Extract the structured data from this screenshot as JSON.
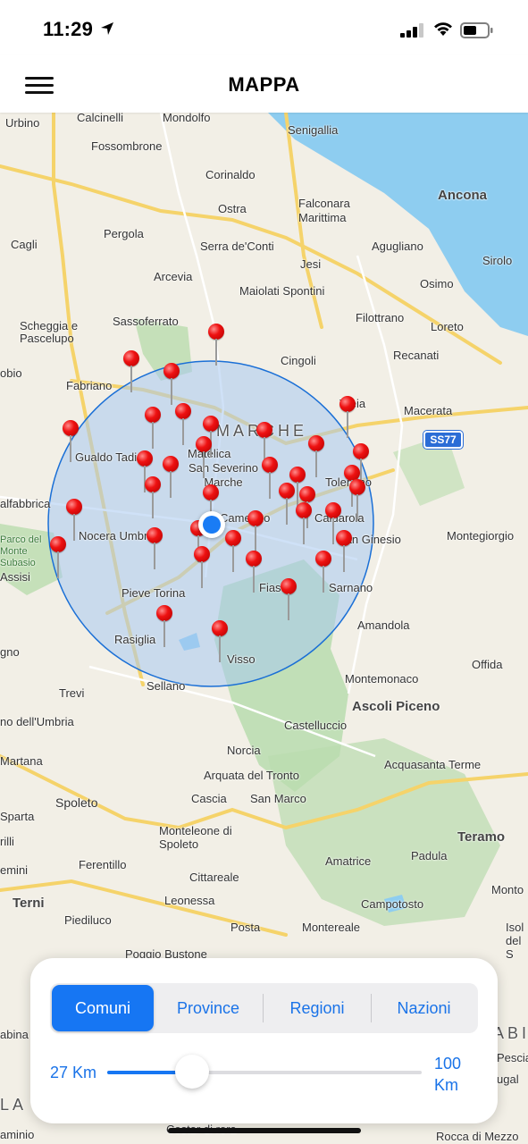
{
  "status_bar": {
    "time": "11:29"
  },
  "nav": {
    "title": "MAPPA"
  },
  "map": {
    "region_label": "MARCHE",
    "road_badge": "SS77",
    "places": [
      {
        "name": "Urbino"
      },
      {
        "name": "Calcinelli"
      },
      {
        "name": "Mondolfo"
      },
      {
        "name": "Senigallia"
      },
      {
        "name": "Fossombrone"
      },
      {
        "name": "Corinaldo"
      },
      {
        "name": "Ostra"
      },
      {
        "name": "Falconara Marittima"
      },
      {
        "name": "Ancona"
      },
      {
        "name": "Cagli"
      },
      {
        "name": "Pergola"
      },
      {
        "name": "Serra de'Conti"
      },
      {
        "name": "Jesi"
      },
      {
        "name": "Agugliano"
      },
      {
        "name": "Sirolo"
      },
      {
        "name": "Arcevia"
      },
      {
        "name": "Osimo"
      },
      {
        "name": "Maiolati Spontini"
      },
      {
        "name": "Scheggia e Pascelupo"
      },
      {
        "name": "Sassoferrato"
      },
      {
        "name": "Filottrano"
      },
      {
        "name": "Loreto"
      },
      {
        "name": "Cingoli"
      },
      {
        "name": "Recanati"
      },
      {
        "name": "Fabriano"
      },
      {
        "name": "obio"
      },
      {
        "name": "Treia"
      },
      {
        "name": "Macerata"
      },
      {
        "name": "Gualdo Tadino"
      },
      {
        "name": "Matelica"
      },
      {
        "name": "San Severino Marche"
      },
      {
        "name": "Tolentino"
      },
      {
        "name": "alfabbrica"
      },
      {
        "name": "Camerino"
      },
      {
        "name": "Caldarola"
      },
      {
        "name": "Nocera Umbra"
      },
      {
        "name": "San Ginesio"
      },
      {
        "name": "Montegiorgio"
      },
      {
        "name": "Parco del Monte Subasio"
      },
      {
        "name": "Assisi"
      },
      {
        "name": "Pieve Torina"
      },
      {
        "name": "Fiastra"
      },
      {
        "name": "Sarnano"
      },
      {
        "name": "Amandola"
      },
      {
        "name": "gno"
      },
      {
        "name": "Rasiglia"
      },
      {
        "name": "Visso"
      },
      {
        "name": "Offida"
      },
      {
        "name": "Sellano"
      },
      {
        "name": "Montemonaco"
      },
      {
        "name": "Trevi"
      },
      {
        "name": "Ascoli Piceno"
      },
      {
        "name": "no dell'Umbria"
      },
      {
        "name": "Castelluccio"
      },
      {
        "name": "Norcia"
      },
      {
        "name": "Martana"
      },
      {
        "name": "Arquata del Tronto"
      },
      {
        "name": "Acquasanta Terme"
      },
      {
        "name": "Spoleto"
      },
      {
        "name": "Cascia"
      },
      {
        "name": "San Marco"
      },
      {
        "name": "Sparta"
      },
      {
        "name": "Monteleone di Spoleto"
      },
      {
        "name": "Teramo"
      },
      {
        "name": "rilli"
      },
      {
        "name": "Ferentillo"
      },
      {
        "name": "Amatrice"
      },
      {
        "name": "Padula"
      },
      {
        "name": "emini"
      },
      {
        "name": "Cittareale"
      },
      {
        "name": "Monto"
      },
      {
        "name": "Terni"
      },
      {
        "name": "Leonessa"
      },
      {
        "name": "Campotosto"
      },
      {
        "name": "Piediluco"
      },
      {
        "name": "Posta"
      },
      {
        "name": "Montereale"
      },
      {
        "name": "Isol del S"
      },
      {
        "name": "Poggio Bustone"
      },
      {
        "name": "abina"
      },
      {
        "name": "Pesciam"
      },
      {
        "name": "ugal"
      },
      {
        "name": "Costar di rora"
      },
      {
        "name": "Rocca di Mezzo"
      },
      {
        "name": "aminio"
      },
      {
        "name": "LA"
      },
      {
        "name": "ABI"
      }
    ]
  },
  "panel": {
    "tabs": [
      "Comuni",
      "Province",
      "Regioni",
      "Nazioni"
    ],
    "active_tab": "Comuni",
    "range_min_label": "27 Km",
    "range_max_label": "100 Km",
    "slider_value_km": 27,
    "slider_min_km": 0,
    "slider_max_km": 100
  },
  "colors": {
    "accent": "#1676f3",
    "pin": "#ee1111",
    "search_radius_fill": "#a8c8f0",
    "search_radius_stroke": "#1a6fd6",
    "water": "#8ecdf0",
    "park": "#b9dcae"
  }
}
